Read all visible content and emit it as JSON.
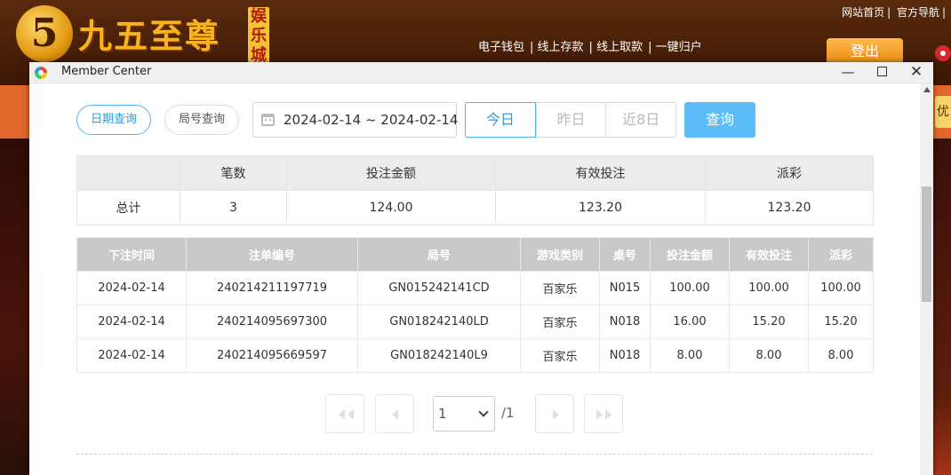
{
  "site": {
    "logo_mark": "5",
    "logo_text": "九五至尊",
    "logo_tag": "娱乐城",
    "top_links": [
      "网站首页",
      "官方导航"
    ],
    "nav_links": [
      "电子钱包",
      "线上存款",
      "线上取款",
      "一键归户"
    ],
    "logout_label": "登出",
    "side_tab": "优"
  },
  "window": {
    "title": "Member Center"
  },
  "filters": {
    "tab_date": "日期查询",
    "tab_round": "局号查询",
    "date_range": "2024-02-14 ~ 2024-02-14",
    "quick": [
      "今日",
      "昨日",
      "近8日"
    ],
    "quick_active": 0,
    "query_label": "查询"
  },
  "summary": {
    "headers": [
      "",
      "笔数",
      "投注金额",
      "有效投注",
      "派彩"
    ],
    "row": [
      "总计",
      "3",
      "124.00",
      "123.20",
      "123.20"
    ]
  },
  "details": {
    "headers": [
      "下注时间",
      "注单编号",
      "局号",
      "游戏类别",
      "桌号",
      "投注金额",
      "有效投注",
      "派彩"
    ],
    "rows": [
      [
        "2024-02-14",
        "240214211197719",
        "GN015242141CD",
        "百家乐",
        "N015",
        "100.00",
        "100.00",
        "100.00"
      ],
      [
        "2024-02-14",
        "240214095697300",
        "GN018242140LD",
        "百家乐",
        "N018",
        "16.00",
        "15.20",
        "15.20"
      ],
      [
        "2024-02-14",
        "240214095669597",
        "GN018242140L9",
        "百家乐",
        "N018",
        "8.00",
        "8.00",
        "8.00"
      ]
    ]
  },
  "pager": {
    "current_page": "1",
    "total_pages": "/1"
  }
}
